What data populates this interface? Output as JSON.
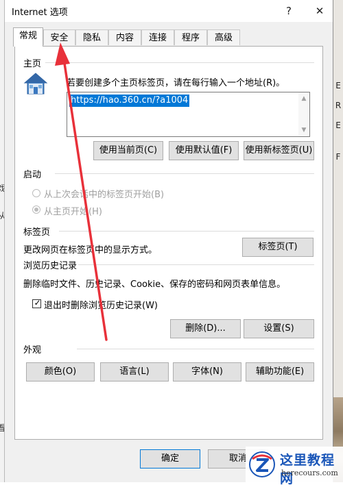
{
  "window": {
    "title": "Internet 选项",
    "help": "?",
    "close": "✕"
  },
  "tabs": [
    "常规",
    "安全",
    "隐私",
    "内容",
    "连接",
    "程序",
    "高级"
  ],
  "homepage": {
    "label": "主页",
    "instruction": "若要创建多个主页标签页，请在每行输入一个地址(R)。",
    "url": "https://hao.360.cn/?a1004",
    "buttons": {
      "current": "使用当前页(C)",
      "default": "使用默认值(F)",
      "new_tab": "使用新标签页(U)"
    }
  },
  "startup": {
    "label": "启动",
    "option_last": "从上次会话中的标签页开始(B)",
    "option_home": "从主页开始(H)"
  },
  "tabs_section": {
    "label": "标签页",
    "description": "更改网页在标签页中的显示方式。",
    "button": "标签页(T)"
  },
  "history": {
    "label": "浏览历史记录",
    "description": "删除临时文件、历史记录、Cookie、保存的密码和网页表单信息。",
    "checkbox_label": "退出时删除浏览历史记录(W)",
    "delete_button": "删除(D)...",
    "settings_button": "设置(S)"
  },
  "appearance": {
    "label": "外观",
    "buttons": {
      "colors": "颜色(O)",
      "languages": "语言(L)",
      "fonts": "字体(N)",
      "accessibility": "辅助功能(E)"
    }
  },
  "footer": {
    "ok": "确定",
    "cancel": "取消"
  },
  "background": {
    "right_fragments": [
      "E",
      "R",
      "E",
      "F"
    ],
    "left_fragments": [
      "戏",
      "从",
      "看"
    ]
  },
  "watermark": {
    "title": "这里教程网",
    "url": "herecours.com"
  },
  "colors": {
    "accent": "#0078d7",
    "arrow": "#e8313a",
    "watermark_blue": "#1a56b8"
  }
}
